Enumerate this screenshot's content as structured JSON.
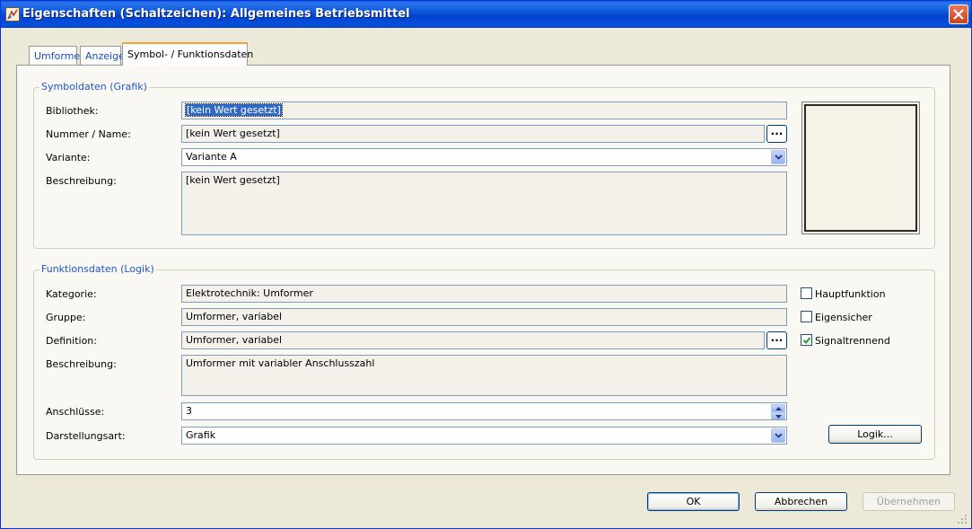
{
  "window": {
    "title": "Eigenschaften (Schaltzeichen): Allgemeines Betriebsmittel"
  },
  "tabs": [
    {
      "label": "Umformer"
    },
    {
      "label": "Anzeige"
    },
    {
      "label": "Symbol- / Funktionsdaten"
    }
  ],
  "symbol_group": {
    "legend": "Symboldaten (Grafik)",
    "library_label": "Bibliothek:",
    "library_value": "[kein Wert gesetzt]",
    "number_label": "Nummer / Name:",
    "number_value": "[kein Wert gesetzt]",
    "variant_label": "Variante:",
    "variant_value": "Variante A",
    "description_label": "Beschreibung:",
    "description_value": "[kein Wert gesetzt]",
    "browse_label": "..."
  },
  "function_group": {
    "legend": "Funktionsdaten (Logik)",
    "category_label": "Kategorie:",
    "category_value": "Elektrotechnik: Umformer",
    "group_label": "Gruppe:",
    "group_value": "Umformer, variabel",
    "definition_label": "Definition:",
    "definition_value": "Umformer, variabel",
    "description_label": "Beschreibung:",
    "description_value": "Umformer mit variabler Anschlusszahl",
    "connections_label": "Anschlüsse:",
    "connections_value": "3",
    "representation_label": "Darstellungsart:",
    "representation_value": "Grafik",
    "browse_label": "...",
    "main_function_label": "Hauptfunktion",
    "main_function_checked": false,
    "intrinsic_safe_label": "Eigensicher",
    "intrinsic_safe_checked": false,
    "signal_separating_label": "Signaltrennend",
    "signal_separating_checked": true,
    "logic_button_label": "Logik..."
  },
  "footer": {
    "ok_label": "OK",
    "cancel_label": "Abbrechen",
    "apply_label": "Übernehmen"
  },
  "colors": {
    "titlebar": "#0a53d6",
    "group_legend": "#1f55c7",
    "active_tab_accent": "#f5a43a"
  }
}
